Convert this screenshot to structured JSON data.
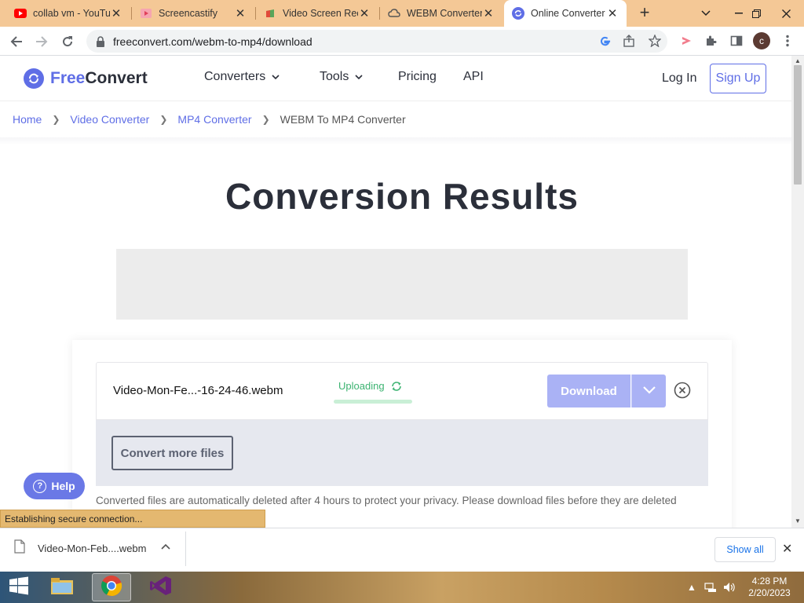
{
  "browser": {
    "tabs": [
      {
        "title": "collab vm - YouTube",
        "active": false
      },
      {
        "title": "Screencastify",
        "active": false
      },
      {
        "title": "Video Screen Recorder",
        "active": false
      },
      {
        "title": "WEBM Converter",
        "active": false
      },
      {
        "title": "Online Converter",
        "active": true
      }
    ],
    "url": "freeconvert.com/webm-to-mp4/download",
    "profile_initial": "c"
  },
  "site": {
    "logo_free": "Free",
    "logo_convert": "Convert",
    "nav": [
      {
        "label": "Converters",
        "dropdown": true
      },
      {
        "label": "Tools",
        "dropdown": true
      },
      {
        "label": "Pricing",
        "dropdown": false
      },
      {
        "label": "API",
        "dropdown": false
      }
    ],
    "login": "Log In",
    "signup": "Sign Up",
    "accent": "#5f6ee6"
  },
  "breadcrumb": [
    "Home",
    "Video Converter",
    "MP4 Converter",
    "WEBM To MP4 Converter"
  ],
  "main": {
    "title": "Conversion Results",
    "file": {
      "name": "Video-Mon-Fe...-16-24-46.webm",
      "status": "Uploading",
      "status_color": "#3cb371",
      "download_label": "Download"
    },
    "convert_more": "Convert more files",
    "notice": "Converted files are automatically deleted after 4 hours to protect your privacy. Please download files before they are deleted"
  },
  "help": {
    "label": "Help"
  },
  "status_bar": "Establishing secure connection...",
  "downloads": {
    "file_name": "Video-Mon-Feb....webm",
    "show_all": "Show all"
  },
  "taskbar": {
    "time": "4:28 PM",
    "date": "2/20/2023"
  }
}
